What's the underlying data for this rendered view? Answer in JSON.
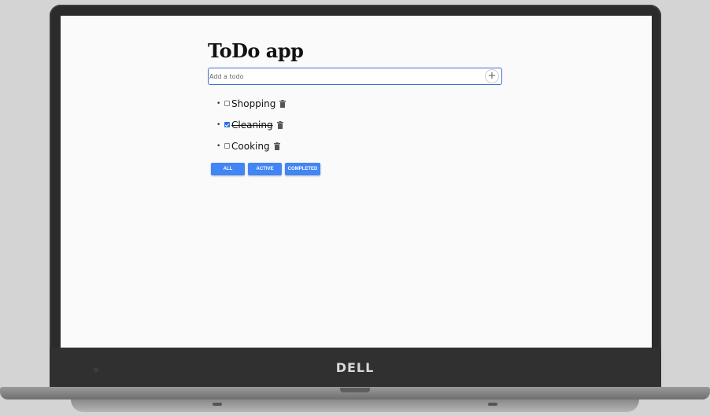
{
  "device": {
    "brand": "DELL"
  },
  "app": {
    "title": "ToDo app",
    "add_input": {
      "value": "",
      "placeholder": "Add a todo"
    },
    "add_button_label": "+",
    "todos": [
      {
        "text": "Shopping",
        "completed": false
      },
      {
        "text": "Cleaning",
        "completed": true
      },
      {
        "text": "Cooking",
        "completed": false
      }
    ],
    "filters": [
      "ALL",
      "ACTIVE",
      "COMPLETED"
    ]
  },
  "colors": {
    "accent": "#4285f4",
    "input_border": "#3f6fd1",
    "screen_background": "#fafafa"
  },
  "icons": {
    "add": "plus-icon",
    "delete": "trash-icon",
    "bullet": "bullet-dot"
  }
}
